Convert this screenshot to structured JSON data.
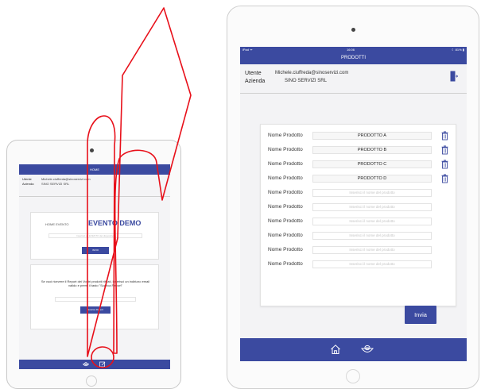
{
  "small_ipad": {
    "nav_title": "HOME",
    "user_label": "Utente",
    "user_value": "Michele.ciuffreda@sinoservizi.com",
    "company_label": "Azienda",
    "company_value": "SINO SERVIZI SRL",
    "event_label": "HOME EVENTO",
    "event_title": "EVENTO DEMO",
    "event_placeholder": "Inserisci un EVENTO del dispositivo",
    "event_button": "INVIO",
    "report_message": "Se vuoi ricevere il Report dei Vostri prodotti ritirati, inserisci un indirizzo email valido e premi il tasto \"Scarica Report\"",
    "report_button": "Scarica Report"
  },
  "large_ipad": {
    "status_left": "iPad ᯤ",
    "status_time": "16:06",
    "status_right": "☾ 81% ▮",
    "nav_title": "PRODOTTI",
    "user_label": "Utente",
    "user_value": "Michele.ciuffreda@sinoservizi.com",
    "company_label": "Azienda",
    "company_value": "SINO SERVIZI SRL",
    "row_label": "Nome Prodotto",
    "placeholder": "Inserisci il nome del prodotto",
    "products": [
      "PRODOTTO A",
      "PRODOTTO B",
      "PRODOTTO C",
      "PRODOTTO D"
    ],
    "send_button": "Invia"
  },
  "colors": {
    "brand_blue": "#3b4aa0",
    "arrow_red": "#e8101a"
  },
  "icons": [
    "logout-door-icon",
    "trash-icon",
    "home-icon",
    "sushi-bowl-icon",
    "edit-icon"
  ]
}
